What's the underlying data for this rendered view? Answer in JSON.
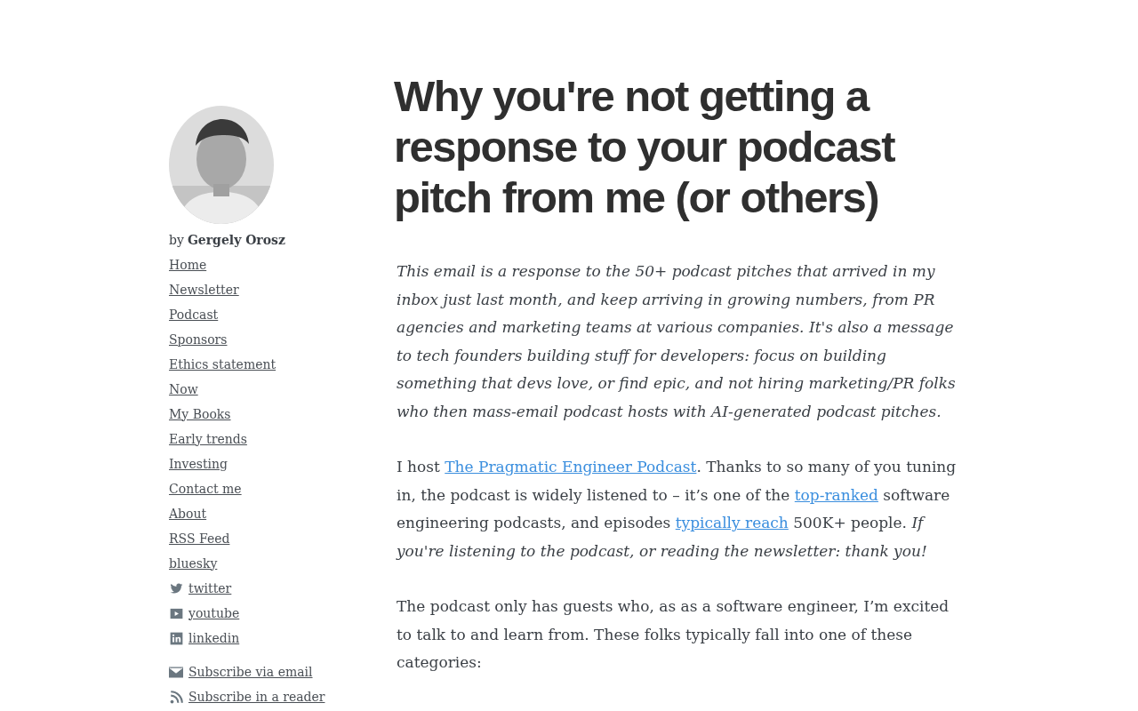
{
  "author": {
    "prefix": "by",
    "name": "Gergely Orosz"
  },
  "nav": [
    {
      "label": "Home"
    },
    {
      "label": "Newsletter"
    },
    {
      "label": "Podcast"
    },
    {
      "label": "Sponsors"
    },
    {
      "label": "Ethics statement"
    },
    {
      "label": "Now"
    },
    {
      "label": "My Books"
    },
    {
      "label": "Early trends"
    },
    {
      "label": "Investing"
    },
    {
      "label": "Contact me"
    },
    {
      "label": "About"
    },
    {
      "label": "RSS Feed"
    },
    {
      "label": "bluesky"
    },
    {
      "label": "twitter",
      "kind": "bird"
    },
    {
      "label": "youtube",
      "kind": "play"
    },
    {
      "label": "linkedin",
      "kind": "in"
    }
  ],
  "subscribe": [
    {
      "label": "Subscribe via email",
      "kind": "envelope"
    },
    {
      "label": "Subscribe in a reader",
      "kind": "rss"
    }
  ],
  "article": {
    "title": "Why you're not getting a response to your podcast pitch from me (or others)",
    "paragraphs": [
      [
        {
          "kind": "italic",
          "text": "This email is a response to the 50+ podcast pitches that arrived in my inbox just last month, and keep arriving in growing numbers, from PR agencies and marketing teams at various companies. It's also a message to tech founders building stuff for developers: focus on building something that devs love, or find epic, and not hiring marketing/PR folks who then mass-email podcast hosts with AI-generated podcast pitches."
        }
      ],
      [
        {
          "kind": "text",
          "text": "I host "
        },
        {
          "kind": "link",
          "text": "The Pragmatic Engineer Podcast"
        },
        {
          "kind": "text",
          "text": ". Thanks to so many of you tuning in, the podcast is widely listened to – it’s one of the "
        },
        {
          "kind": "link",
          "text": "top-ranked"
        },
        {
          "kind": "text",
          "text": " software engineering podcasts, and episodes "
        },
        {
          "kind": "link",
          "text": "typically reach"
        },
        {
          "kind": "text",
          "text": " 500K+ people. "
        },
        {
          "kind": "italic",
          "text": "If you're listening to the podcast, or reading the newsletter: thank you!"
        }
      ],
      [
        {
          "kind": "text",
          "text": "The podcast only has guests who, as as a software engineer, I’m excited to talk to and learn from. These folks typically fall into one of these categories:"
        }
      ]
    ]
  }
}
